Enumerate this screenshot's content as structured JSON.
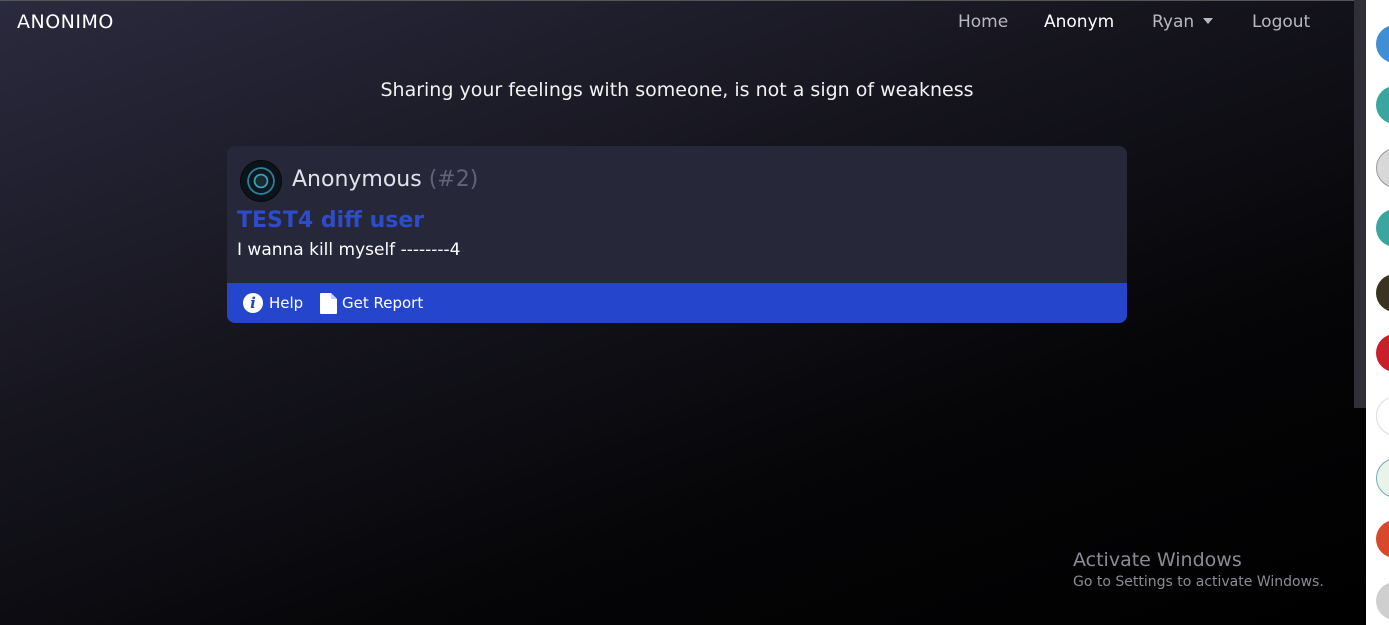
{
  "navbar": {
    "brand": "ANONIMO",
    "items": [
      {
        "label": "Home"
      },
      {
        "label": "Anonym"
      },
      {
        "label": "Ryan"
      },
      {
        "label": "Logout"
      }
    ]
  },
  "tagline": "Sharing your feelings with someone, is not a sign of weakness",
  "post": {
    "author": "Anonymous",
    "number": "(#2)",
    "title": "TEST4 diff user",
    "body": "I wanna kill myself --------4",
    "actions": {
      "help": "Help",
      "report": "Get Report"
    }
  },
  "watermark": {
    "title": "Activate Windows",
    "subtitle": "Go to Settings to activate Windows."
  },
  "colors": {
    "accent": "#2546cc",
    "title_link": "#2e4bc9",
    "card_bg": "#27273a"
  },
  "icons": [
    "info-icon",
    "document-icon",
    "chevron-down-icon"
  ]
}
